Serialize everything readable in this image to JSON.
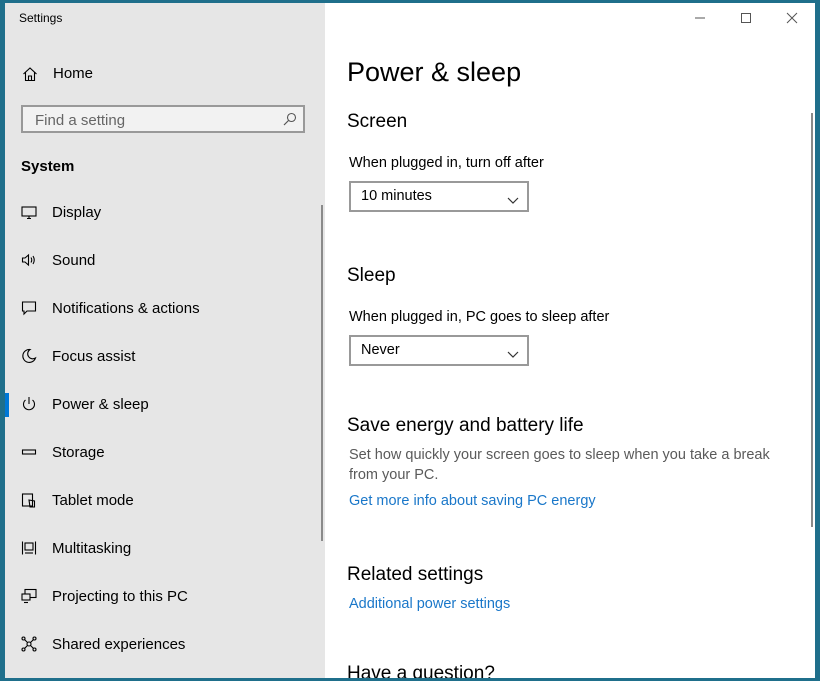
{
  "window": {
    "title": "Settings",
    "controls": {
      "minimize": "—",
      "maximize": "☐",
      "close": "✕"
    }
  },
  "sidebar": {
    "home": {
      "label": "Home",
      "icon": "home-icon"
    },
    "search": {
      "placeholder": "Find a setting",
      "value": "",
      "icon": "search-icon"
    },
    "section_heading": "System",
    "items": [
      {
        "label": "Display",
        "icon": "display-icon"
      },
      {
        "label": "Sound",
        "icon": "sound-icon"
      },
      {
        "label": "Notifications & actions",
        "icon": "notifications-icon"
      },
      {
        "label": "Focus assist",
        "icon": "focus-assist-icon"
      },
      {
        "label": "Power & sleep",
        "icon": "power-icon",
        "selected": true
      },
      {
        "label": "Storage",
        "icon": "storage-icon"
      },
      {
        "label": "Tablet mode",
        "icon": "tablet-mode-icon"
      },
      {
        "label": "Multitasking",
        "icon": "multitasking-icon"
      },
      {
        "label": "Projecting to this PC",
        "icon": "projecting-icon"
      },
      {
        "label": "Shared experiences",
        "icon": "shared-experiences-icon"
      }
    ]
  },
  "main": {
    "title": "Power & sleep",
    "screen": {
      "heading": "Screen",
      "label": "When plugged in, turn off after",
      "value": "10 minutes"
    },
    "sleep": {
      "heading": "Sleep",
      "label": "When plugged in, PC goes to sleep after",
      "value": "Never"
    },
    "energy": {
      "heading": "Save energy and battery life",
      "description": "Set how quickly your screen goes to sleep when you take a break from your PC.",
      "link": "Get more info about saving PC energy"
    },
    "related": {
      "heading": "Related settings",
      "link": "Additional power settings"
    },
    "question": {
      "heading": "Have a question?"
    }
  },
  "colors": {
    "accent": "#0078d7",
    "link": "#1a77c9",
    "sidebar_bg": "#e6e6e6",
    "border": "#1f6f8b"
  }
}
